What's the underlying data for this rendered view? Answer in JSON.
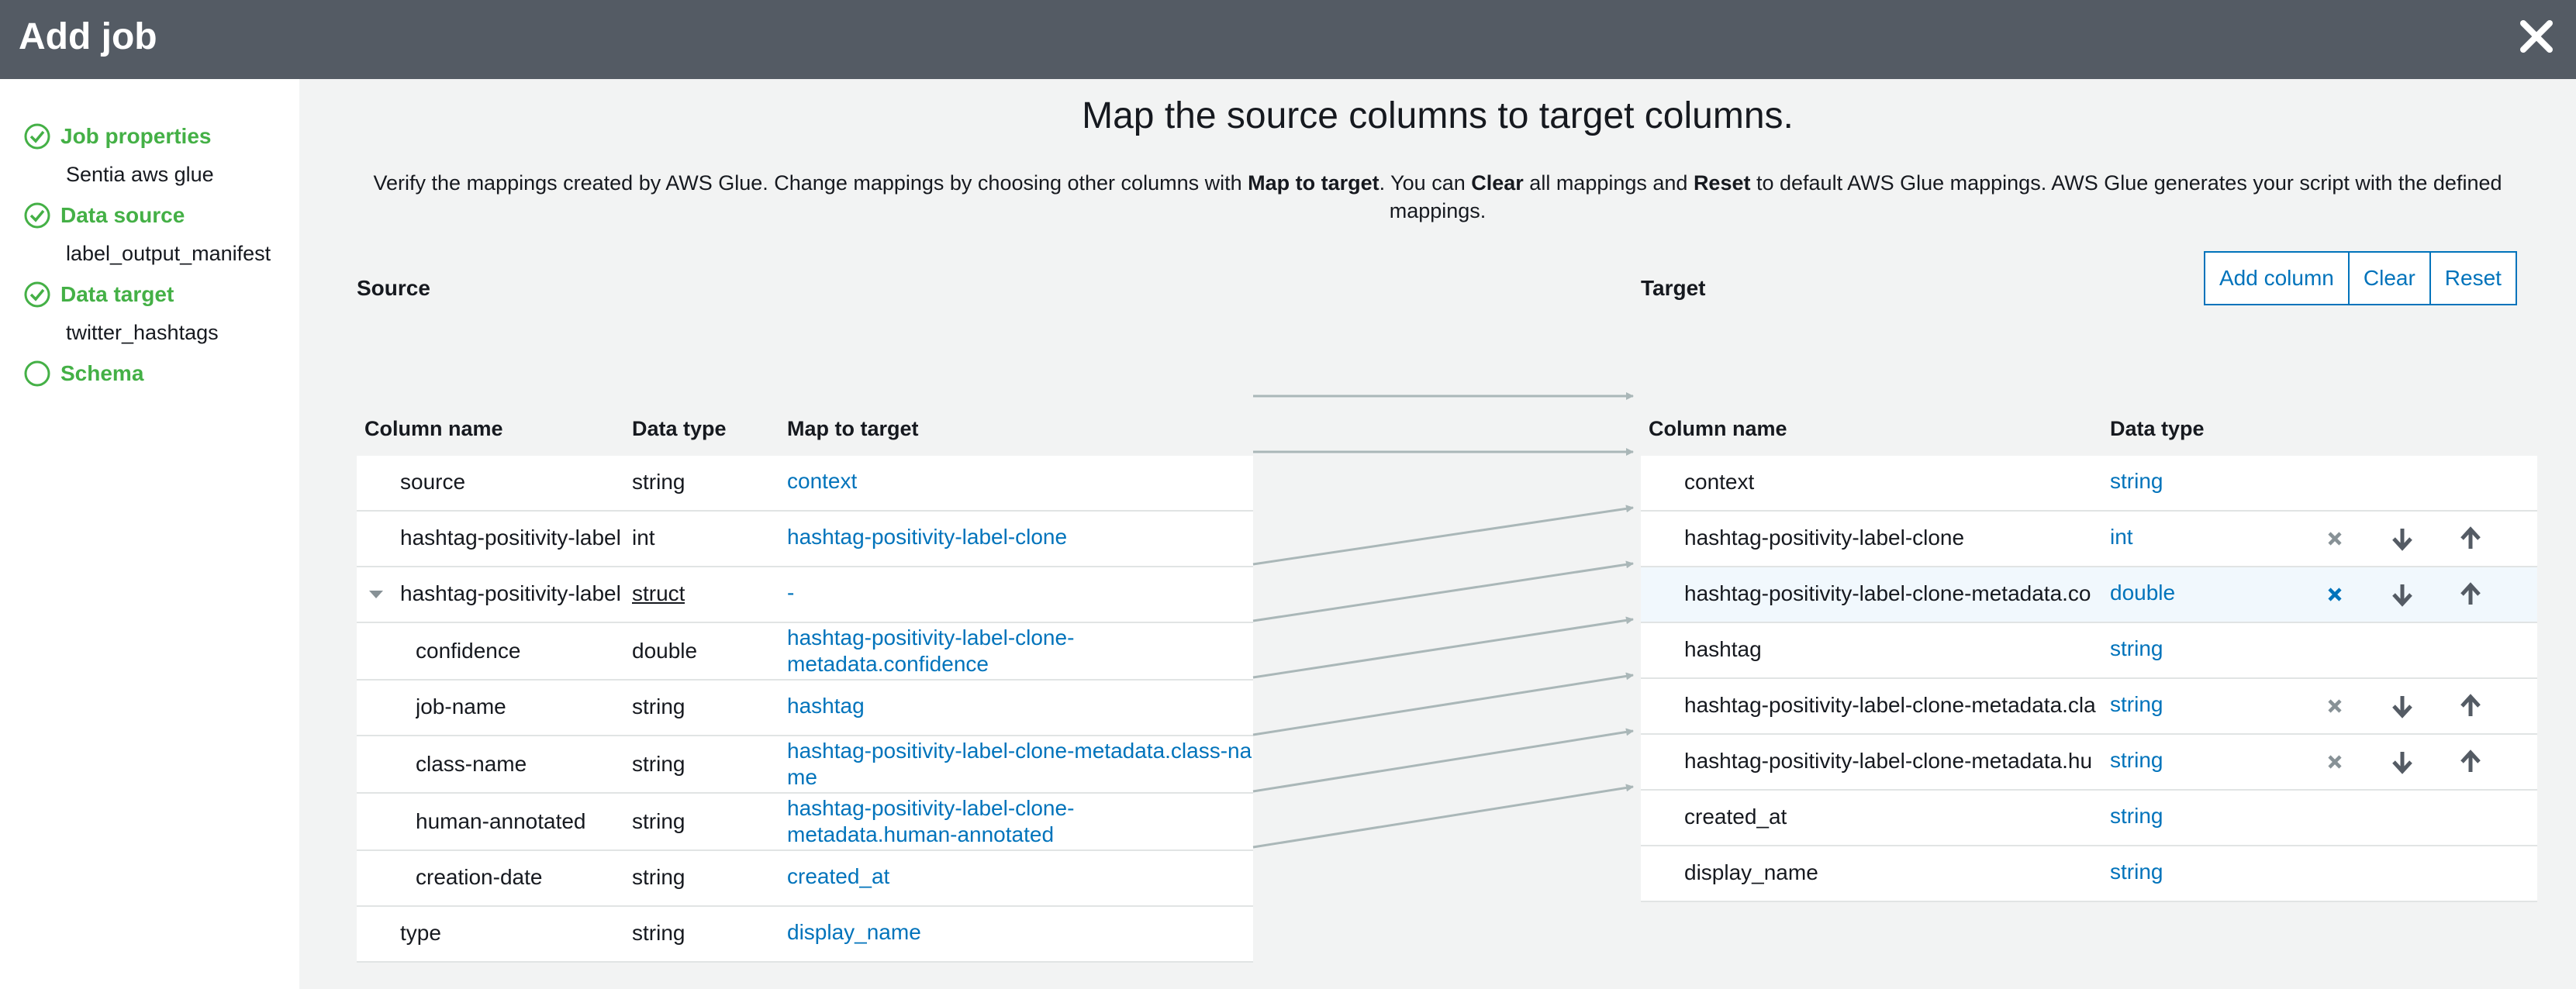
{
  "header": {
    "title": "Add job"
  },
  "sidebar": {
    "steps": [
      {
        "label": "Job properties",
        "sub": "Sentia aws glue",
        "done": true
      },
      {
        "label": "Data source",
        "sub": "label_output_manifest",
        "done": true
      },
      {
        "label": "Data target",
        "sub": "twitter_hashtags",
        "done": true
      },
      {
        "label": "Schema",
        "sub": "",
        "done": false
      }
    ]
  },
  "main": {
    "heading": "Map the source columns to target columns.",
    "desc": {
      "p1": "Verify the mappings created by AWS Glue. Change mappings by choosing other columns with ",
      "b1": "Map to target",
      "p2": ". You can ",
      "b2": "Clear",
      "p3": " all mappings and ",
      "b3": "Reset",
      "p4": " to default AWS Glue mappings. AWS Glue generates your script with the defined mappings."
    }
  },
  "source": {
    "label": "Source",
    "headers": {
      "name": "Column name",
      "type": "Data type",
      "map": "Map to target"
    },
    "rows": [
      {
        "name": "source",
        "type": "string",
        "map": "context"
      },
      {
        "name": "hashtag-positivity-label",
        "type": "int",
        "map": "hashtag-positivity-label-clone"
      },
      {
        "name": "hashtag-positivity-label",
        "type": "struct",
        "map": "-"
      },
      {
        "name": "confidence",
        "type": "double",
        "map": "hashtag-positivity-label-clone-metadata.confidence"
      },
      {
        "name": "job-name",
        "type": "string",
        "map": "hashtag"
      },
      {
        "name": "class-name",
        "type": "string",
        "map": "hashtag-positivity-label-clone-metadata.class-name"
      },
      {
        "name": "human-annotated",
        "type": "string",
        "map": "hashtag-positivity-label-clone-metadata.human-annotated"
      },
      {
        "name": "creation-date",
        "type": "string",
        "map": "created_at"
      },
      {
        "name": "type",
        "type": "string",
        "map": "display_name"
      }
    ]
  },
  "target": {
    "label": "Target",
    "buttons": {
      "add": "Add column",
      "clear": "Clear",
      "reset": "Reset"
    },
    "headers": {
      "name": "Column name",
      "type": "Data type"
    },
    "rows": [
      {
        "name": "context",
        "type": "string"
      },
      {
        "name": "hashtag-positivity-label-clone",
        "type": "int"
      },
      {
        "name": "hashtag-positivity-label-clone-metadata.co",
        "type": "double"
      },
      {
        "name": "hashtag",
        "type": "string"
      },
      {
        "name": "hashtag-positivity-label-clone-metadata.cla",
        "type": "string"
      },
      {
        "name": "hashtag-positivity-label-clone-metadata.hu",
        "type": "string"
      },
      {
        "name": "created_at",
        "type": "string"
      },
      {
        "name": "display_name",
        "type": "string"
      }
    ]
  },
  "colors": {
    "accent": "#0073bb",
    "success": "#44b046",
    "header": "#545b64"
  }
}
